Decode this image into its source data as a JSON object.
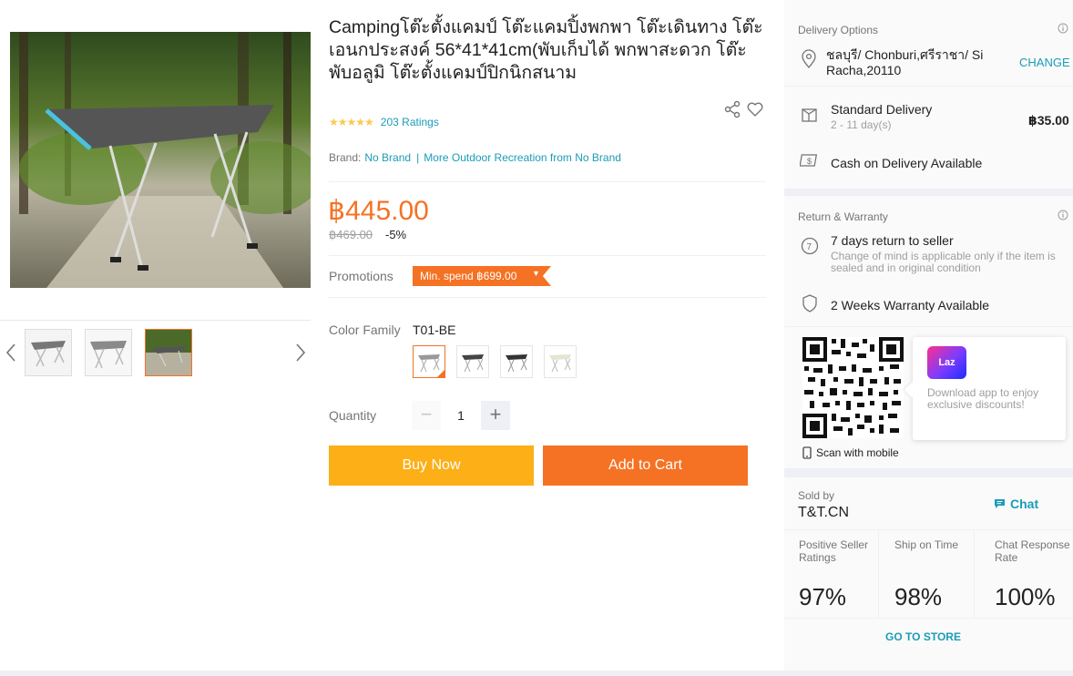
{
  "product": {
    "title": "Campingโต๊ะตั้งแคมป์ โต๊ะแคมปิ้งพกพา โต๊ะเดินทาง โต๊ะเอนกประสงค์ 56*41*41cm(พับเก็บได้ พกพาสะดวก โต๊ะพับอลูมิ โต๊ะตั้งแคมป์ปิกนิกสนาม",
    "stars": "★★★★★",
    "rating_count": "203 Ratings",
    "brand_label": "Brand:",
    "brand_name": "No Brand",
    "more_from": "More Outdoor Recreation from No Brand",
    "price": "฿445.00",
    "original_price": "฿469.00",
    "discount": "-5%",
    "promotions_label": "Promotions",
    "promo_tag": "Min. spend ฿699.00",
    "color_label": "Color Family",
    "color_value": "T01-BE",
    "quantity_label": "Quantity",
    "quantity": "1",
    "buy_now": "Buy Now",
    "add_to_cart": "Add to Cart"
  },
  "delivery": {
    "title": "Delivery Options",
    "location": "ชลบุรี/ Chonburi,ศรีราชา/ Si Racha,20110",
    "change": "CHANGE",
    "standard_title": "Standard Delivery",
    "standard_eta": "2 - 11 day(s)",
    "standard_price": "฿35.00",
    "cod": "Cash on Delivery Available"
  },
  "warranty": {
    "title": "Return & Warranty",
    "return_title": "7 days return to seller",
    "return_sub": "Change of mind is applicable only if the item is sealed and in original condition",
    "warranty_text": "2 Weeks Warranty Available"
  },
  "app": {
    "logo_text": "Laz",
    "text": "Download app to enjoy exclusive discounts!",
    "scan": "Scan with mobile"
  },
  "seller": {
    "sold_by_label": "Sold by",
    "name": "T&T.CN",
    "chat": "Chat",
    "metrics": [
      {
        "label": "Positive Seller Ratings",
        "value": "97%"
      },
      {
        "label": "Ship on Time",
        "value": "98%"
      },
      {
        "label": "Chat Response Rate",
        "value": "100%"
      }
    ],
    "go_to_store": "GO TO STORE"
  },
  "colors": {
    "accent": "#f57224",
    "buy": "#fcaf17",
    "link": "#1a9cb7",
    "star": "#faca51"
  }
}
